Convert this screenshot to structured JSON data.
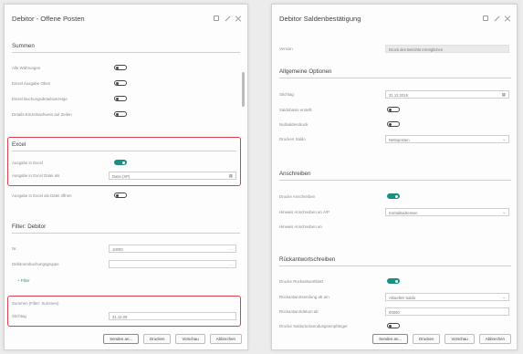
{
  "left": {
    "title": "Debitor - Offene Posten",
    "sections": {
      "summen": "Summen",
      "excel": "Excel",
      "filter": "Filter: Debitor",
      "summen_filter": "Summen (Filter: Summen)"
    },
    "summen_rows": [
      {
        "label": "Alle Währungen",
        "on": false
      },
      {
        "label": "Einzel Ausgabe Oben",
        "on": false
      },
      {
        "label": "Einzel Buchungsdetailsanzeige",
        "on": false
      },
      {
        "label": "Details-Einzelnachweis auf Zeilen",
        "on": false
      }
    ],
    "excel_rows": [
      {
        "label": "Ausgabe in Excel",
        "on": true
      },
      {
        "label": "Ausgabe in Excel Datei als",
        "value": "Datei (XP)"
      }
    ],
    "after_excel": {
      "label": "Ausgabe in Excel als Datei öffnen",
      "on": false
    },
    "filter_rows": [
      {
        "label": "Nr.",
        "value": "10000"
      },
      {
        "label": "Debitorenbuchungsgruppe",
        "value": ""
      }
    ],
    "filter_link": "+ Filter",
    "summen_filter_row": {
      "label": "Stichtag",
      "value": "31.12.09"
    }
  },
  "right": {
    "title": "Debitor Saldenbestätigung",
    "top_row": {
      "label": "Version",
      "value": "Druck des Berichts ermöglichen"
    },
    "sections": {
      "general": "Allgemeine Optionen",
      "anschreiben": "Anschreiben",
      "rueck": "Rückantwortschreiben"
    },
    "general_rows": [
      {
        "label": "Stichtag",
        "value": "31.12.2019",
        "icon": "calendar-icon"
      },
      {
        "label": "Saldobasis erstellt",
        "on": false
      },
      {
        "label": "Nullsaldendruck",
        "on": false
      },
      {
        "label": "Drucken Saldo",
        "value": "Nettoposten",
        "icon": "chevron-down-icon"
      }
    ],
    "anschreiben_rows": [
      {
        "label": "Drucke Anschreiben",
        "on": true
      },
      {
        "label": "Hinweis Anschreiben an A/P",
        "value": "Kontaktadressen",
        "icon": "chevron-down-icon"
      },
      {
        "label": "Hinweis Anschreiben an",
        "value": ""
      }
    ],
    "rueck_rows": [
      {
        "label": "Drucke Rückantwortblatt",
        "on": true
      },
      {
        "label": "Rückantwortsendung ab am",
        "value": "Aktuellen Saldo",
        "icon": "chevron-down-icon"
      },
      {
        "label": "Rückantwortdatum ab",
        "value": "00000"
      },
      {
        "label": "Drucke Saldorücksendungsempfänger",
        "on": false
      }
    ]
  },
  "buttons": [
    "Senden an...",
    "Drucken",
    "Vorschau",
    "Abbrechen"
  ]
}
